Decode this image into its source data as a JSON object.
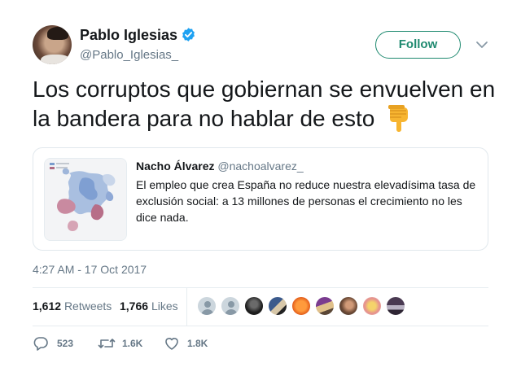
{
  "author": {
    "name": "Pablo Iglesias",
    "handle": "@Pablo_Iglesias_",
    "verified": true,
    "avatar_icon": "profile-photo"
  },
  "follow_button_label": "Follow",
  "menu_icon": "chevron-down-icon",
  "tweet_text": "Los corruptos que gobiernan se envuelven en la bandera para no hablar de esto",
  "tweet_emoji": "pointing-down-hand-emoji",
  "quoted_tweet": {
    "author_name": "Nacho Álvarez",
    "author_handle": "@nachoalvarez_",
    "text": "El empleo que crea España no reduce nuestra elevadísima tasa de exclusión social: a 13 millones de personas el crecimiento no les dice nada.",
    "image_icon": "europe-map-thumbnail"
  },
  "timestamp": "4:27 AM - 17 Oct 2017",
  "stats": {
    "retweets_count": "1,612",
    "retweets_label": "Retweets",
    "likes_count": "1,766",
    "likes_label": "Likes"
  },
  "actions": {
    "reply_count": "523",
    "retweet_count": "1.6K",
    "like_count": "1.8K"
  },
  "colors": {
    "follow_accent": "#1f8a70",
    "verified_blue": "#1da1f2",
    "muted_text": "#657786"
  }
}
